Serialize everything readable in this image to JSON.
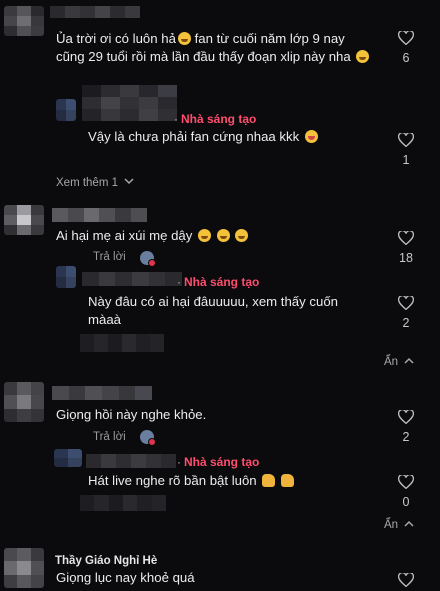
{
  "comments": [
    {
      "text": "Ủa trời ơi có luôn hả",
      "text_cont": " fan từ cuối năm lớp 9 nay cũng 29 tuổi rồi mà lần đầu thấy đoạn xlip này nha",
      "likes": "6"
    },
    {
      "text": "Ai hại mẹ ai xúi mẹ dậy",
      "likes": "18",
      "reply_label": "Trả lời"
    },
    {
      "text": "Giọng hồi này nghe khỏe.",
      "likes": "2",
      "reply_label": "Trả lời"
    },
    {
      "author": "Thầy Giáo Nghỉ Hè",
      "text": "Giọng lục nay khoẻ quá"
    }
  ],
  "replies": [
    {
      "badge": "Nhà sáng tạo",
      "text": "Vậy là chưa phải fan cứng nhaa kkk",
      "likes": "1"
    },
    {
      "badge": "Nhà sáng tạo",
      "text": "Này đâu có ai hại đâuuuuu, xem thấy cuốn màaà",
      "likes": "2"
    },
    {
      "badge": "Nhà sáng tạo",
      "text": "Hát live nghe rõ bần bật luôn",
      "likes": "0"
    }
  ],
  "view_more_label": "Xem thêm 1",
  "hide_label": "Ẩn",
  "icons": {
    "like": "heart-outline-icon",
    "chevron_down": "chevron-down-icon",
    "chevron_up": "chevron-up-icon"
  },
  "colors": {
    "background": "#0b0b0d",
    "creator_badge": "#ff4d6d",
    "text": "#ececec"
  }
}
